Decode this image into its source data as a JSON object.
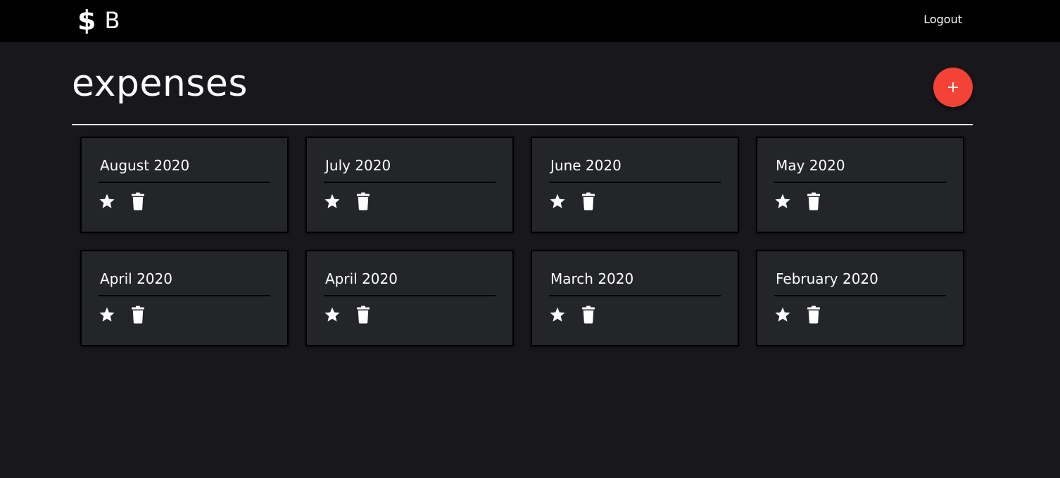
{
  "navbar": {
    "brand_symbol": "$",
    "brand_letter": "B",
    "logout_label": "Logout"
  },
  "page": {
    "title": "expenses",
    "add_label": "+"
  },
  "colors": {
    "accent": "#f44336",
    "background": "#18181c",
    "card": "#242529",
    "navbar": "#000000"
  },
  "icons": {
    "favorite": "star-icon",
    "delete": "trash-icon"
  },
  "cards": [
    {
      "title": "August 2020"
    },
    {
      "title": "July 2020"
    },
    {
      "title": "June 2020"
    },
    {
      "title": "May 2020"
    },
    {
      "title": "April 2020"
    },
    {
      "title": "April 2020"
    },
    {
      "title": "March 2020"
    },
    {
      "title": "February 2020"
    }
  ]
}
